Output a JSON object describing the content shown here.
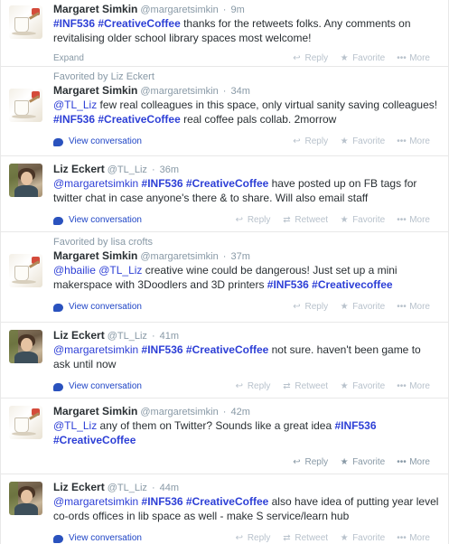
{
  "labels": {
    "reply": "Reply",
    "retweet": "Retweet",
    "favorite": "Favorite",
    "more": "More",
    "expand": "Expand",
    "view_conversation": "View conversation"
  },
  "icons": {
    "reply": "reply-icon",
    "retweet": "retweet-icon",
    "favorite": "star-icon",
    "more": "more-icon",
    "conversation": "speech-bubble-icon"
  },
  "colors": {
    "hashtag": "#2d3fd6",
    "link": "#1f45c6",
    "muted": "#8899a6"
  },
  "tweets": [
    {
      "context": "",
      "name": "Margaret Simkin",
      "handle": "@margaretsimkin",
      "time": "9m",
      "avatar": "coffee-cup",
      "text": [
        {
          "t": "tag",
          "v": "#INF536"
        },
        {
          "t": "txt",
          "v": " "
        },
        {
          "t": "tag",
          "v": "#CreativeCoffee"
        },
        {
          "t": "txt",
          "v": "  thanks for the retweets folks. Any comments on revitalising older school library spaces most welcome!"
        }
      ],
      "footer": "expand",
      "retweet": false
    },
    {
      "context": "Favorited by Liz Eckert",
      "name": "Margaret Simkin",
      "handle": "@margaretsimkin",
      "time": "34m",
      "avatar": "coffee-cup",
      "text": [
        {
          "t": "at",
          "v": "@TL_Liz"
        },
        {
          "t": "txt",
          "v": " few real colleagues in this space, only virtual sanity saving colleagues! "
        },
        {
          "t": "tag",
          "v": "#INF536"
        },
        {
          "t": "txt",
          "v": " "
        },
        {
          "t": "tag",
          "v": "#CreativeCoffee"
        },
        {
          "t": "txt",
          "v": " real coffee pals collab. 2morrow"
        }
      ],
      "footer": "convo",
      "retweet": false
    },
    {
      "context": "",
      "name": "Liz Eckert",
      "handle": "@TL_Liz",
      "time": "36m",
      "avatar": "liz",
      "text": [
        {
          "t": "at",
          "v": "@margaretsimkin"
        },
        {
          "t": "txt",
          "v": " "
        },
        {
          "t": "tag",
          "v": "#INF536"
        },
        {
          "t": "txt",
          "v": " "
        },
        {
          "t": "tag",
          "v": "#CreativeCoffee"
        },
        {
          "t": "txt",
          "v": " have posted up on FB tags for twitter chat in case anyone's there & to share. Will also email staff"
        }
      ],
      "footer": "convo",
      "retweet": true
    },
    {
      "context": "Favorited by lisa crofts",
      "name": "Margaret Simkin",
      "handle": "@margaretsimkin",
      "time": "37m",
      "avatar": "coffee-cup",
      "text": [
        {
          "t": "at",
          "v": "@hbailie"
        },
        {
          "t": "txt",
          "v": " "
        },
        {
          "t": "at",
          "v": "@TL_Liz"
        },
        {
          "t": "txt",
          "v": " creative wine could be dangerous! Just set up a mini makerspace with 3Doodlers and 3D printers "
        },
        {
          "t": "tag",
          "v": "#INF536"
        },
        {
          "t": "txt",
          "v": " "
        },
        {
          "t": "tag",
          "v": "#Creativecoffee"
        }
      ],
      "footer": "convo",
      "retweet": false
    },
    {
      "context": "",
      "name": "Liz Eckert",
      "handle": "@TL_Liz",
      "time": "41m",
      "avatar": "liz",
      "text": [
        {
          "t": "at",
          "v": "@margaretsimkin"
        },
        {
          "t": "txt",
          "v": " "
        },
        {
          "t": "tag",
          "v": "#INF536"
        },
        {
          "t": "txt",
          "v": " "
        },
        {
          "t": "tag",
          "v": "#CreativeCoffee"
        },
        {
          "t": "txt",
          "v": " not sure. haven't been game to ask until now"
        }
      ],
      "footer": "convo",
      "retweet": true
    },
    {
      "context": "",
      "name": "Margaret Simkin",
      "handle": "@margaretsimkin",
      "time": "42m",
      "avatar": "coffee-cup",
      "text": [
        {
          "t": "at",
          "v": "@TL_Liz"
        },
        {
          "t": "txt",
          "v": " any of them on Twitter? Sounds like a great idea "
        },
        {
          "t": "tag",
          "v": "#INF536"
        },
        {
          "t": "txt",
          "v": " "
        },
        {
          "t": "tag",
          "v": "#CreativeCoffee"
        }
      ],
      "footer": "convo",
      "retweet": false,
      "actions_active": true
    },
    {
      "context": "",
      "name": "Liz Eckert",
      "handle": "@TL_Liz",
      "time": "44m",
      "avatar": "liz",
      "text": [
        {
          "t": "at",
          "v": "@margaretsimkin"
        },
        {
          "t": "txt",
          "v": " "
        },
        {
          "t": "tag",
          "v": "#INF536"
        },
        {
          "t": "txt",
          "v": " "
        },
        {
          "t": "tag",
          "v": "#CreativeCoffee"
        },
        {
          "t": "txt",
          "v": " also have idea of putting year level co-ords offices in lib space as well - make S service/learn hub"
        }
      ],
      "footer": "convo",
      "retweet": true
    }
  ]
}
